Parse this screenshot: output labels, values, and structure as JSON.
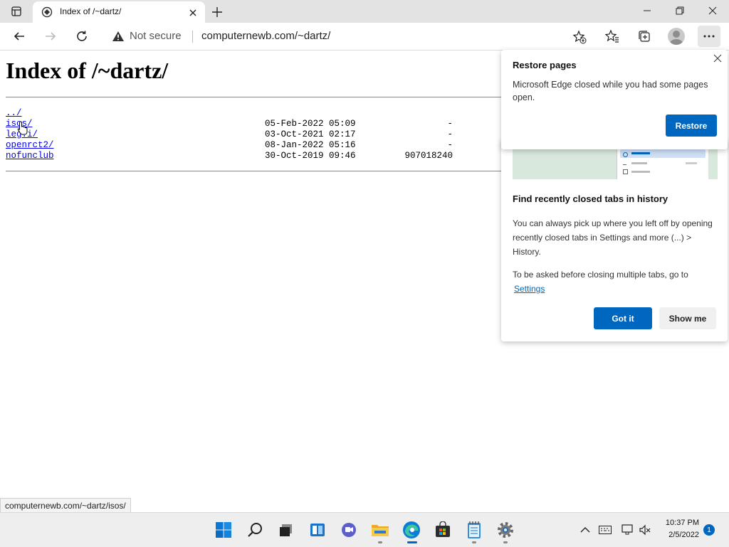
{
  "browser": {
    "tab": {
      "title": "Index of /~dartz/"
    },
    "address": {
      "security": "Not secure",
      "url": "computernewb.com/~dartz/"
    }
  },
  "page": {
    "heading": "Index of /~dartz/",
    "entries": [
      {
        "name": "../",
        "date": "",
        "size": ""
      },
      {
        "name": "isos/",
        "date": "05-Feb-2022 05:09",
        "size": "-"
      },
      {
        "name": "leg.i/",
        "date": "03-Oct-2021 02:17",
        "size": "-"
      },
      {
        "name": "openrct2/",
        "date": "08-Jan-2022 05:16",
        "size": "-"
      },
      {
        "name": "nofunclub",
        "date": "30-Oct-2019 09:46",
        "size": "907018240"
      }
    ]
  },
  "status_bar": {
    "text": "computernewb.com/~dartz/isos/"
  },
  "restore_popup": {
    "title": "Restore pages",
    "body": "Microsoft Edge closed while you had some pages open.",
    "button": "Restore"
  },
  "history_tip": {
    "title": "Find recently closed tabs in history",
    "body": "You can always pick up where you left off by opening recently closed tabs in Settings and more (...) > History.",
    "body2": "To be asked before closing multiple tabs, go to",
    "link": "Settings",
    "primary": "Got it",
    "secondary": "Show me"
  },
  "taskbar": {
    "time": "10:37 PM",
    "date": "2/5/2022",
    "notification_count": "1",
    "accent": "#0067c0"
  }
}
